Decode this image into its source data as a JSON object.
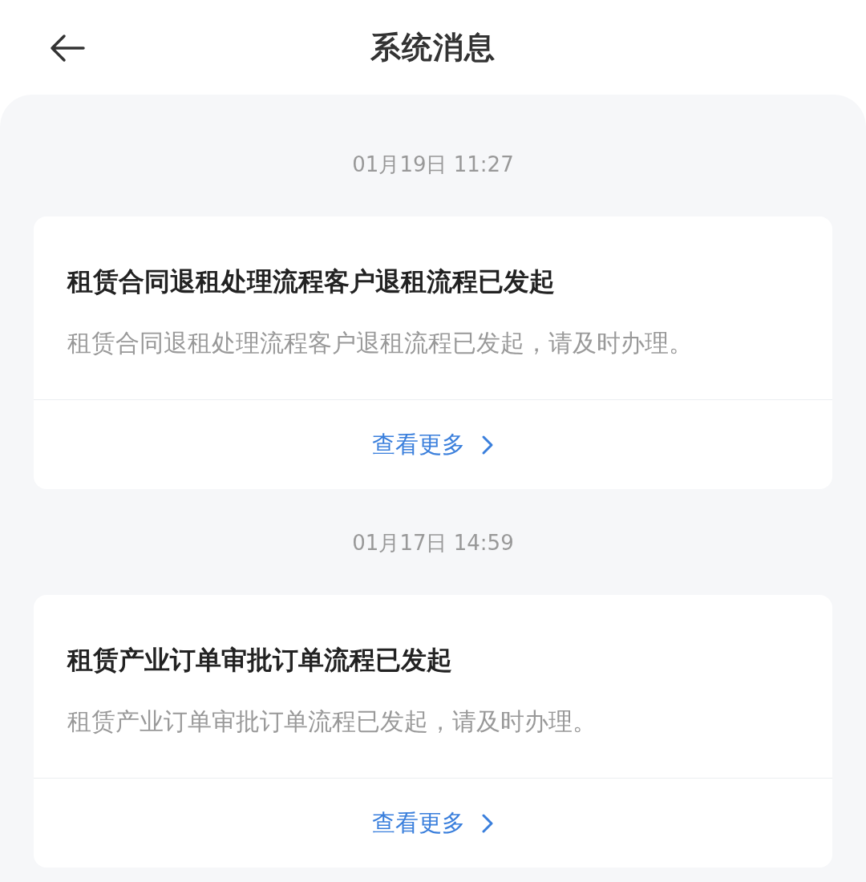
{
  "header": {
    "title": "系统消息"
  },
  "messages": [
    {
      "time": "01月19日 11:27",
      "title": "租赁合同退租处理流程客户退租流程已发起",
      "body": "租赁合同退租处理流程客户退租流程已发起，请及时办理。",
      "link": "查看更多"
    },
    {
      "time": "01月17日 14:59",
      "title": "租赁产业订单审批订单流程已发起",
      "body": "租赁产业订单审批订单流程已发起，请及时办理。",
      "link": "查看更多"
    }
  ]
}
